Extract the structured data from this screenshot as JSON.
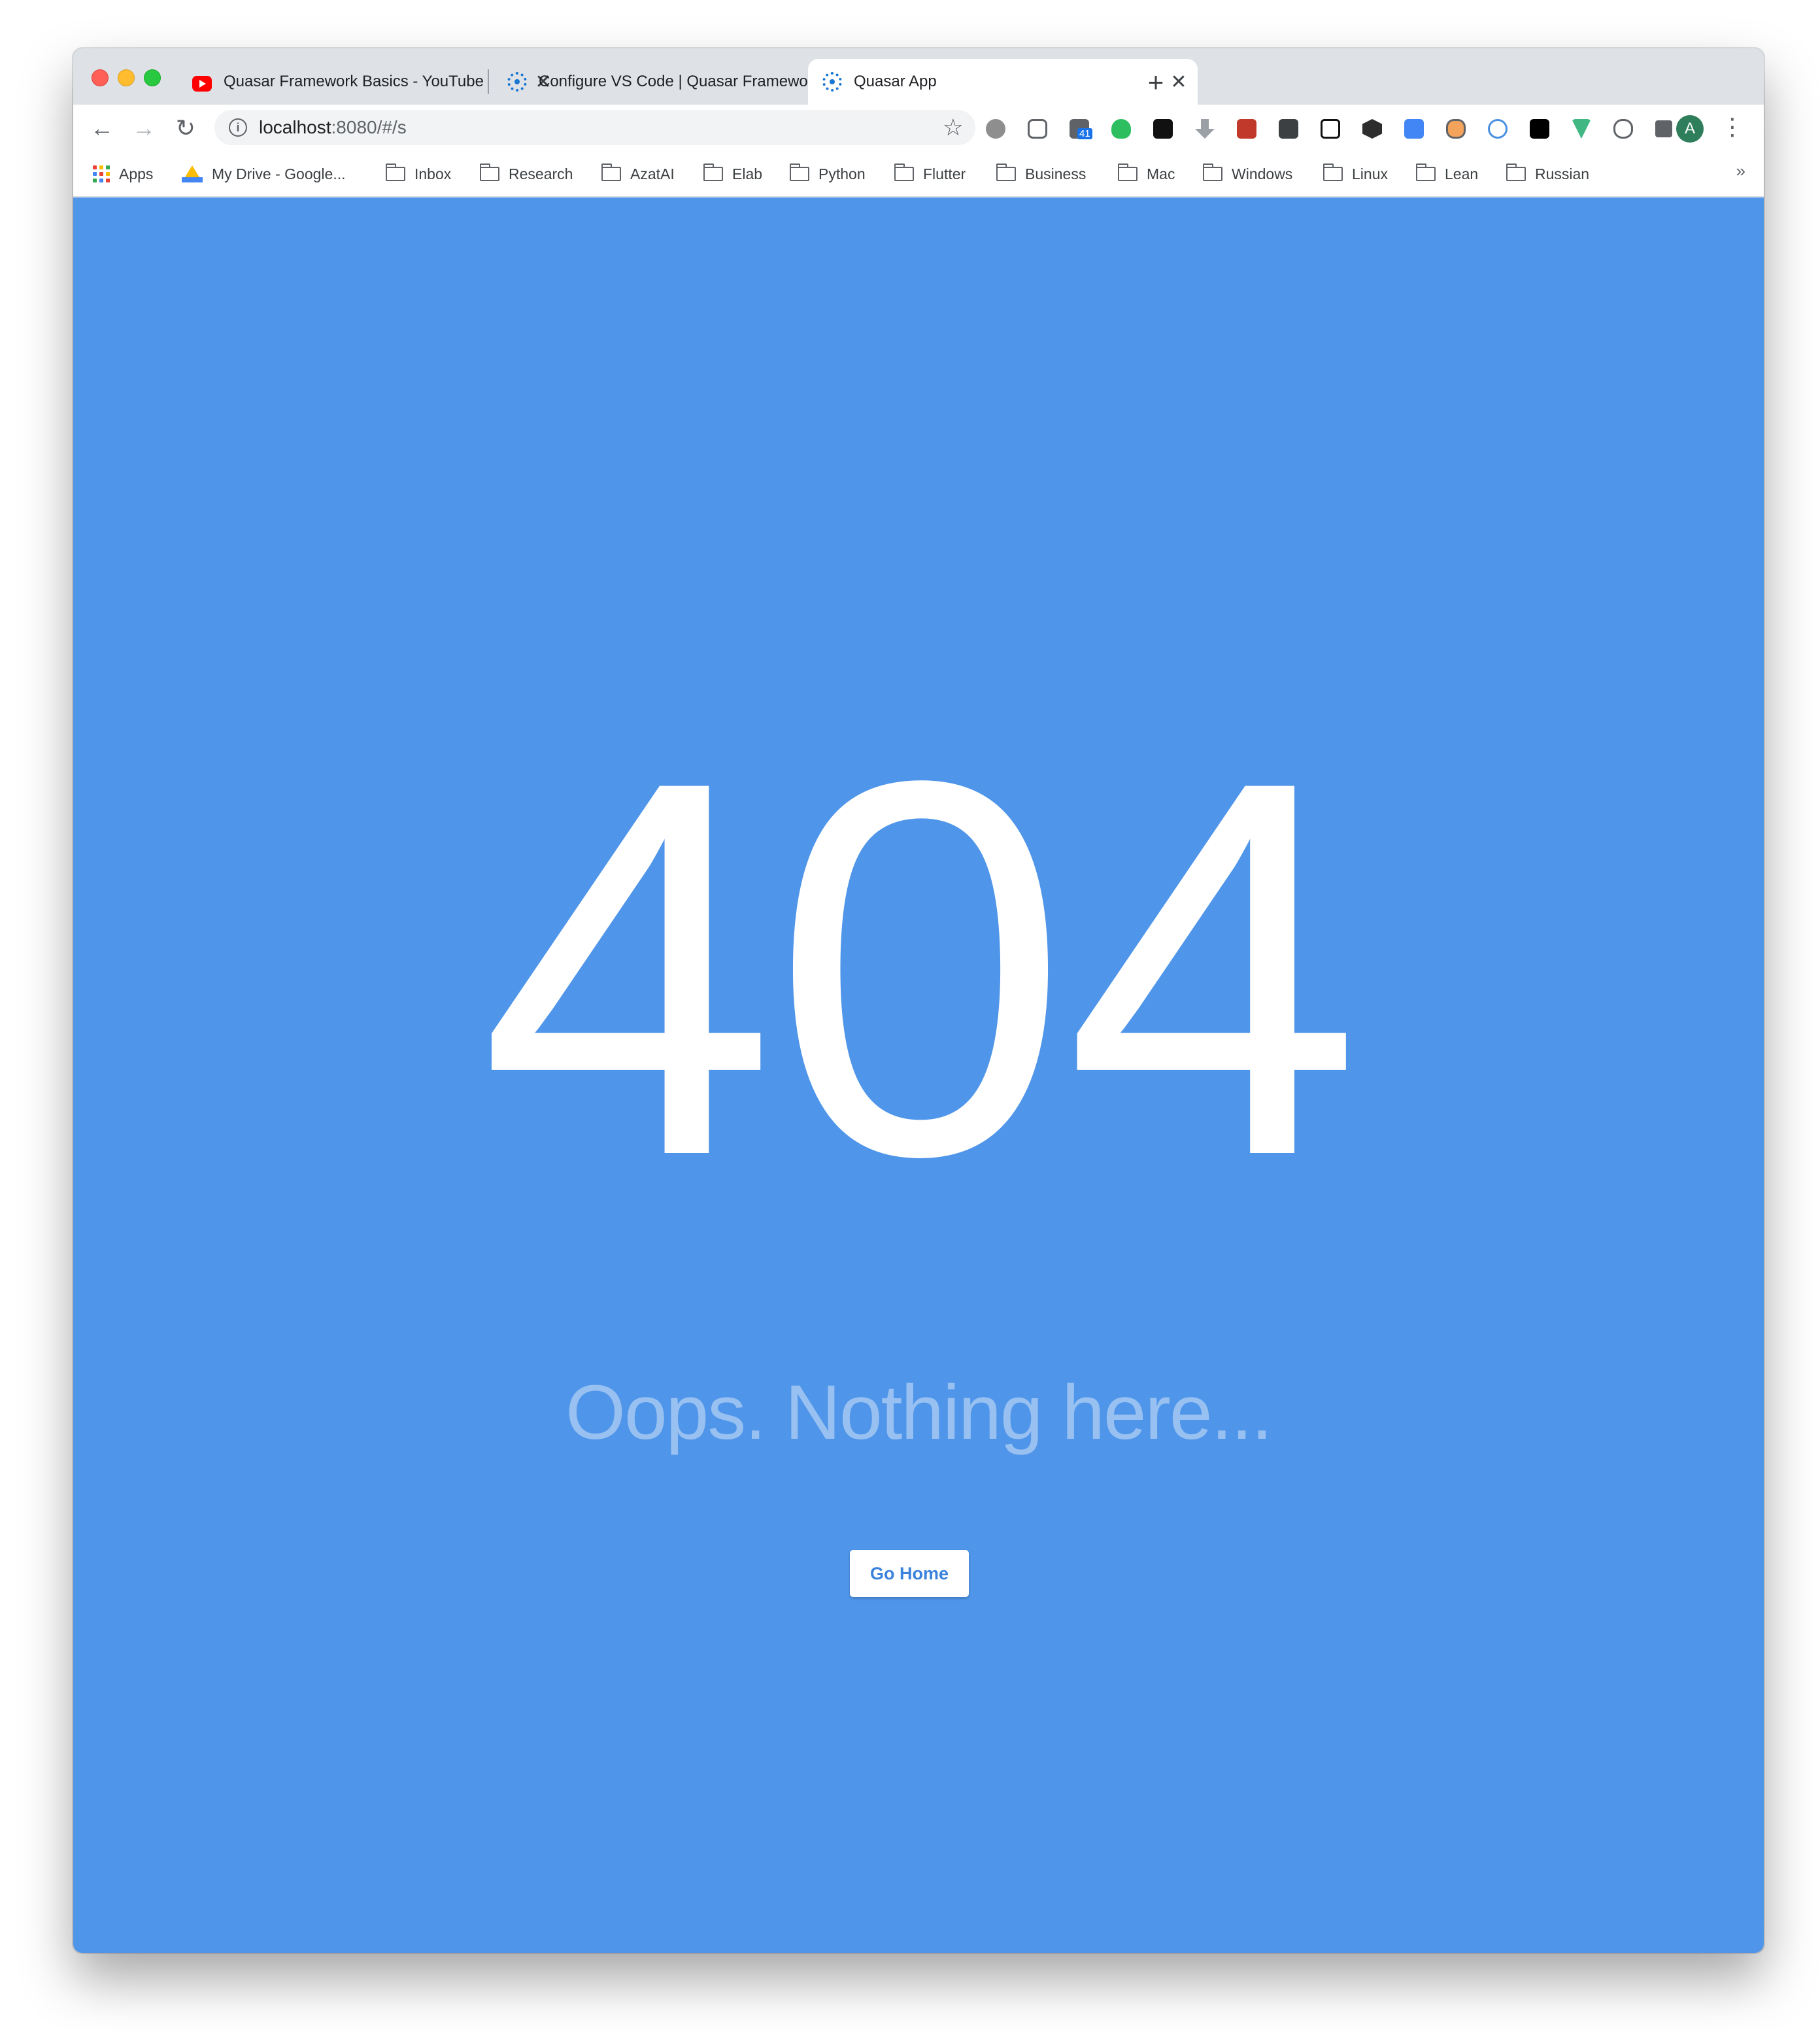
{
  "tabs": [
    {
      "title": "Quasar Framework Basics - YouTube",
      "icon": "youtube-icon",
      "active": false
    },
    {
      "title": "Configure VS Code | Quasar Framework",
      "icon": "quasar-icon",
      "active": false
    },
    {
      "title": "Quasar App",
      "icon": "quasar-icon",
      "active": true
    }
  ],
  "tab_close_glyph": "✕",
  "new_tab_glyph": "+",
  "omnibox": {
    "host": "localhost",
    "rest": ":8080/#/s"
  },
  "extension_badge": "41",
  "avatar_letter": "A",
  "bookmarks": {
    "apps": "Apps",
    "drive": "My Drive - Google...",
    "folders": [
      "Inbox",
      "Research",
      "AzatAI",
      "Elab",
      "Python",
      "Flutter",
      "Business",
      "Mac",
      "Windows",
      "Linux",
      "Lean",
      "Russian"
    ],
    "more": "»"
  },
  "page": {
    "code": "404",
    "message": "Oops. Nothing here...",
    "button": "Go Home",
    "background_color": "#4f95e9"
  }
}
